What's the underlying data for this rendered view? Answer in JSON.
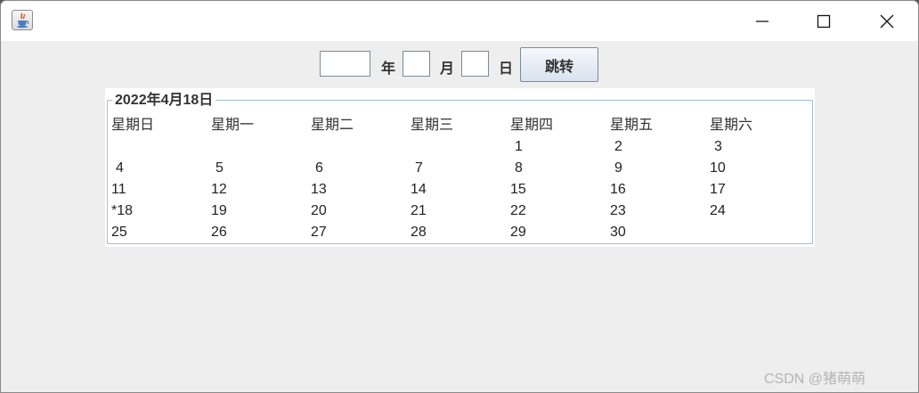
{
  "window": {
    "icon": "java-coffee-cup-icon",
    "controls": [
      "minimize-icon",
      "maximize-icon",
      "close-icon"
    ]
  },
  "toolbar": {
    "year_value": "",
    "month_value": "",
    "day_value": "",
    "year_label": "年",
    "month_label": "月",
    "day_label": "日",
    "jump_label": "跳转"
  },
  "calendar": {
    "title": "2022年4月18日",
    "weekdays": [
      "星期日",
      "星期一",
      "星期二",
      "星期三",
      "星期四",
      "星期五",
      "星期六"
    ],
    "weeks": [
      [
        "",
        "",
        "",
        "",
        "1",
        "2",
        "3"
      ],
      [
        "4",
        "5",
        "6",
        "7",
        "8",
        "9",
        "10"
      ],
      [
        "11",
        "12",
        "13",
        "14",
        "15",
        "16",
        "17"
      ],
      [
        "*18",
        "19",
        "20",
        "21",
        "22",
        "23",
        "24"
      ],
      [
        "25",
        "26",
        "27",
        "28",
        "29",
        "30",
        ""
      ]
    ]
  },
  "watermark": "CSDN @猪萌萌",
  "colors": {
    "window_bg": "#eeeeee",
    "titlebar_bg": "#ffffff",
    "panel_border": "#a9bfd4",
    "button_gradient_bottom": "#d9e2ee"
  }
}
